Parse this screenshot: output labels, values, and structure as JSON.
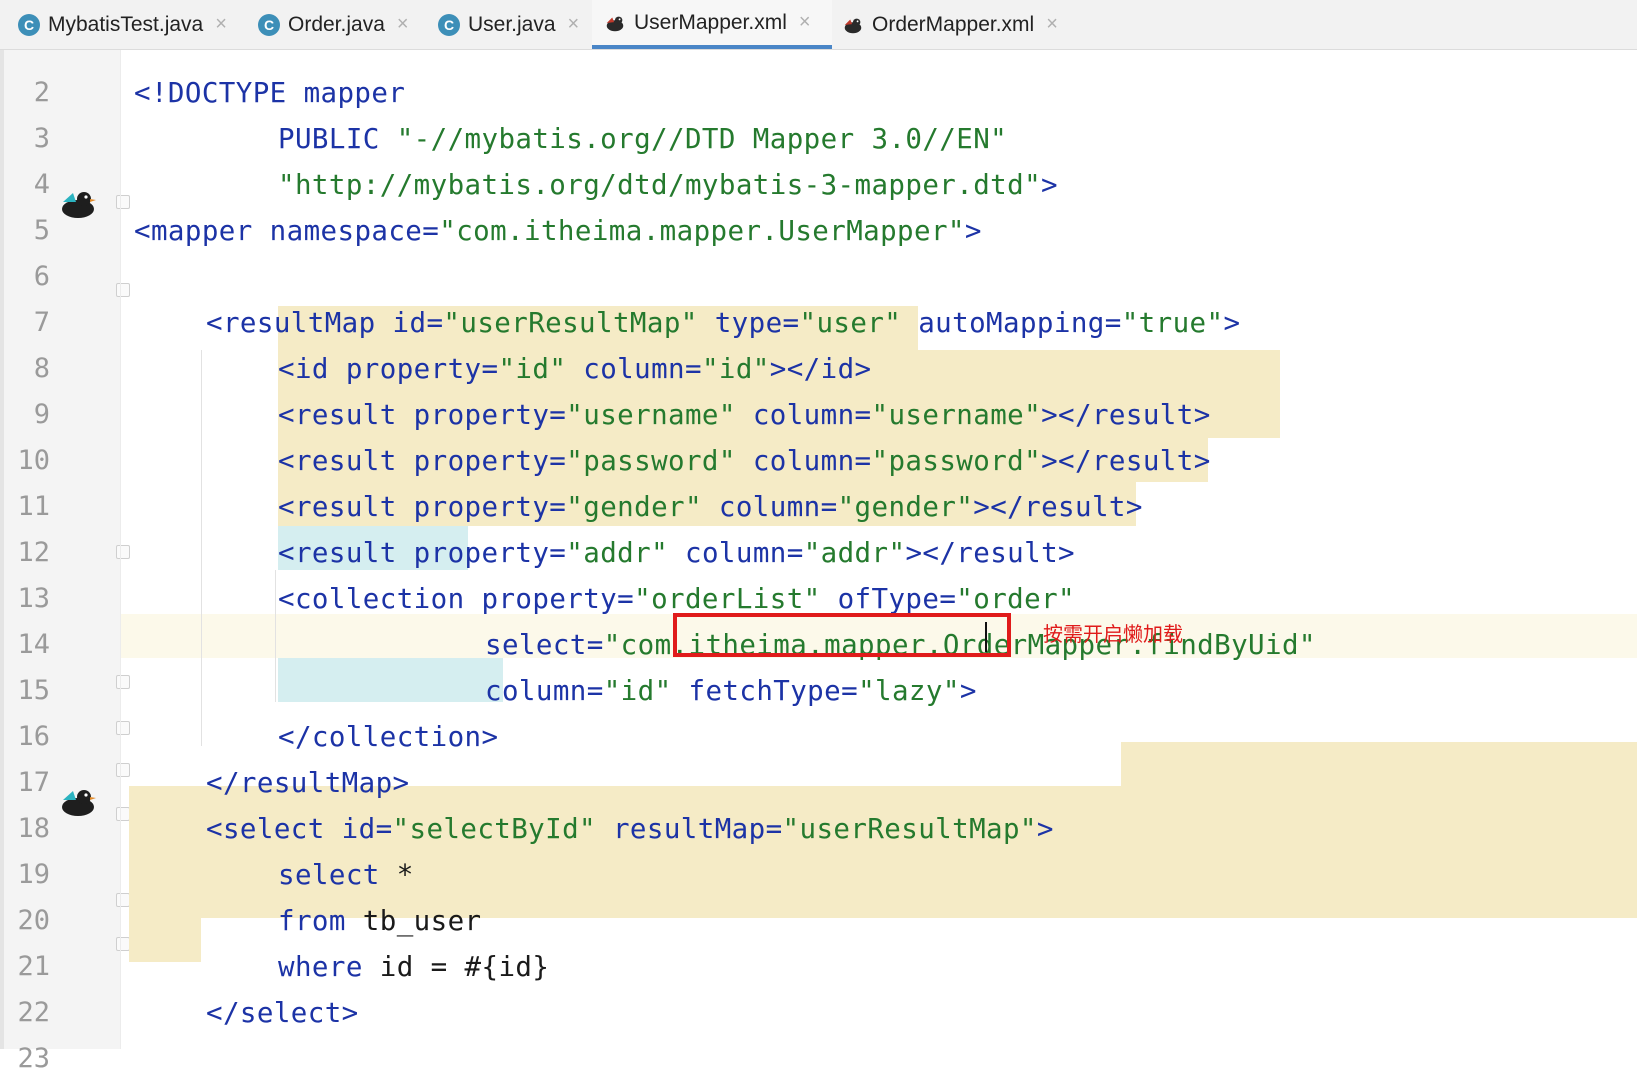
{
  "tabs": [
    {
      "label": "MybatisTest.java",
      "icon": "java-class-icon"
    },
    {
      "label": "Order.java",
      "icon": "java-class-icon"
    },
    {
      "label": "User.java",
      "icon": "java-class-icon"
    },
    {
      "label": "UserMapper.xml",
      "icon": "mybatis-bird-icon",
      "active": true
    },
    {
      "label": "OrderMapper.xml",
      "icon": "mybatis-bird-icon"
    }
  ],
  "tab_close_glyph": "×",
  "line_numbers": [
    "2",
    "3",
    "4",
    "5",
    "6",
    "7",
    "8",
    "9",
    "10",
    "11",
    "12",
    "13",
    "14",
    "15",
    "16",
    "17",
    "18",
    "19",
    "20",
    "21",
    "22",
    "23"
  ],
  "lines": {
    "l2": {
      "a": "<!DOCTYPE",
      "b": " mapper"
    },
    "l3": {
      "a": "PUBLIC ",
      "b": "\"-//mybatis.org//DTD Mapper 3.0//EN\""
    },
    "l4": {
      "a": "\"http://mybatis.org/dtd/mybatis-3-mapper.dtd\"",
      "b": ">"
    },
    "l5": {
      "a": "<mapper",
      "b": " namespace=",
      "c": "\"com.itheima.mapper.UserMapper\"",
      "d": ">"
    },
    "l7": {
      "a": "<resultMap",
      "b": " id=",
      "c": "\"userResultMap\"",
      "d": " type=",
      "e": "\"user\"",
      "f": " autoMapping=",
      "g": "\"true\"",
      "h": ">"
    },
    "l8": {
      "a": "<id",
      "b": " property=",
      "c": "\"id\"",
      "d": " column=",
      "e": "\"id\"",
      "f": "></id>"
    },
    "l9": {
      "a": "<result",
      "b": " property=",
      "c": "\"username\"",
      "d": " column=",
      "e": "\"username\"",
      "f": "></result>"
    },
    "l10": {
      "a": "<result",
      "b": " property=",
      "c": "\"password\"",
      "d": " column=",
      "e": "\"password\"",
      "f": "></result>"
    },
    "l11": {
      "a": "<result",
      "b": " property=",
      "c": "\"gender\"",
      "d": " column=",
      "e": "\"gender\"",
      "f": "></result>"
    },
    "l12": {
      "a": "<result",
      "b": " property=",
      "c": "\"addr\"",
      "d": " column=",
      "e": "\"addr\"",
      "f": "></result>"
    },
    "l13": {
      "a": "<collection",
      "b": " property=",
      "c": "\"orderList\"",
      "d": " ofType=",
      "e": "\"order\""
    },
    "l14": {
      "a": "select=",
      "b": "\"com.itheima.mapper.OrderMapper.findByUid\""
    },
    "l15": {
      "a": "column=",
      "b": "\"id\"",
      "c": " fetchType=",
      "d": "\"lazy\"",
      "e": ">"
    },
    "l16": {
      "a": "</collection>"
    },
    "l17": {
      "a": "</resultMap>"
    },
    "l18": {
      "a": "<select",
      "b": " id=",
      "c": "\"selectById\"",
      "d": " resultMap=",
      "e": "\"userResultMap\"",
      "f": ">"
    },
    "l19": {
      "a": "select",
      "b": " *"
    },
    "l20": {
      "a": "from",
      "b": " tb_user"
    },
    "l21": {
      "a": "where",
      "b": " id = #{id}"
    },
    "l22": {
      "a": "</select>"
    }
  },
  "annotation": "按需开启懒加载",
  "colors": {
    "tag": "#1c33a6",
    "string": "#257a2e",
    "highlight": "#f5ebc6",
    "annotation": "#e01b1b"
  }
}
